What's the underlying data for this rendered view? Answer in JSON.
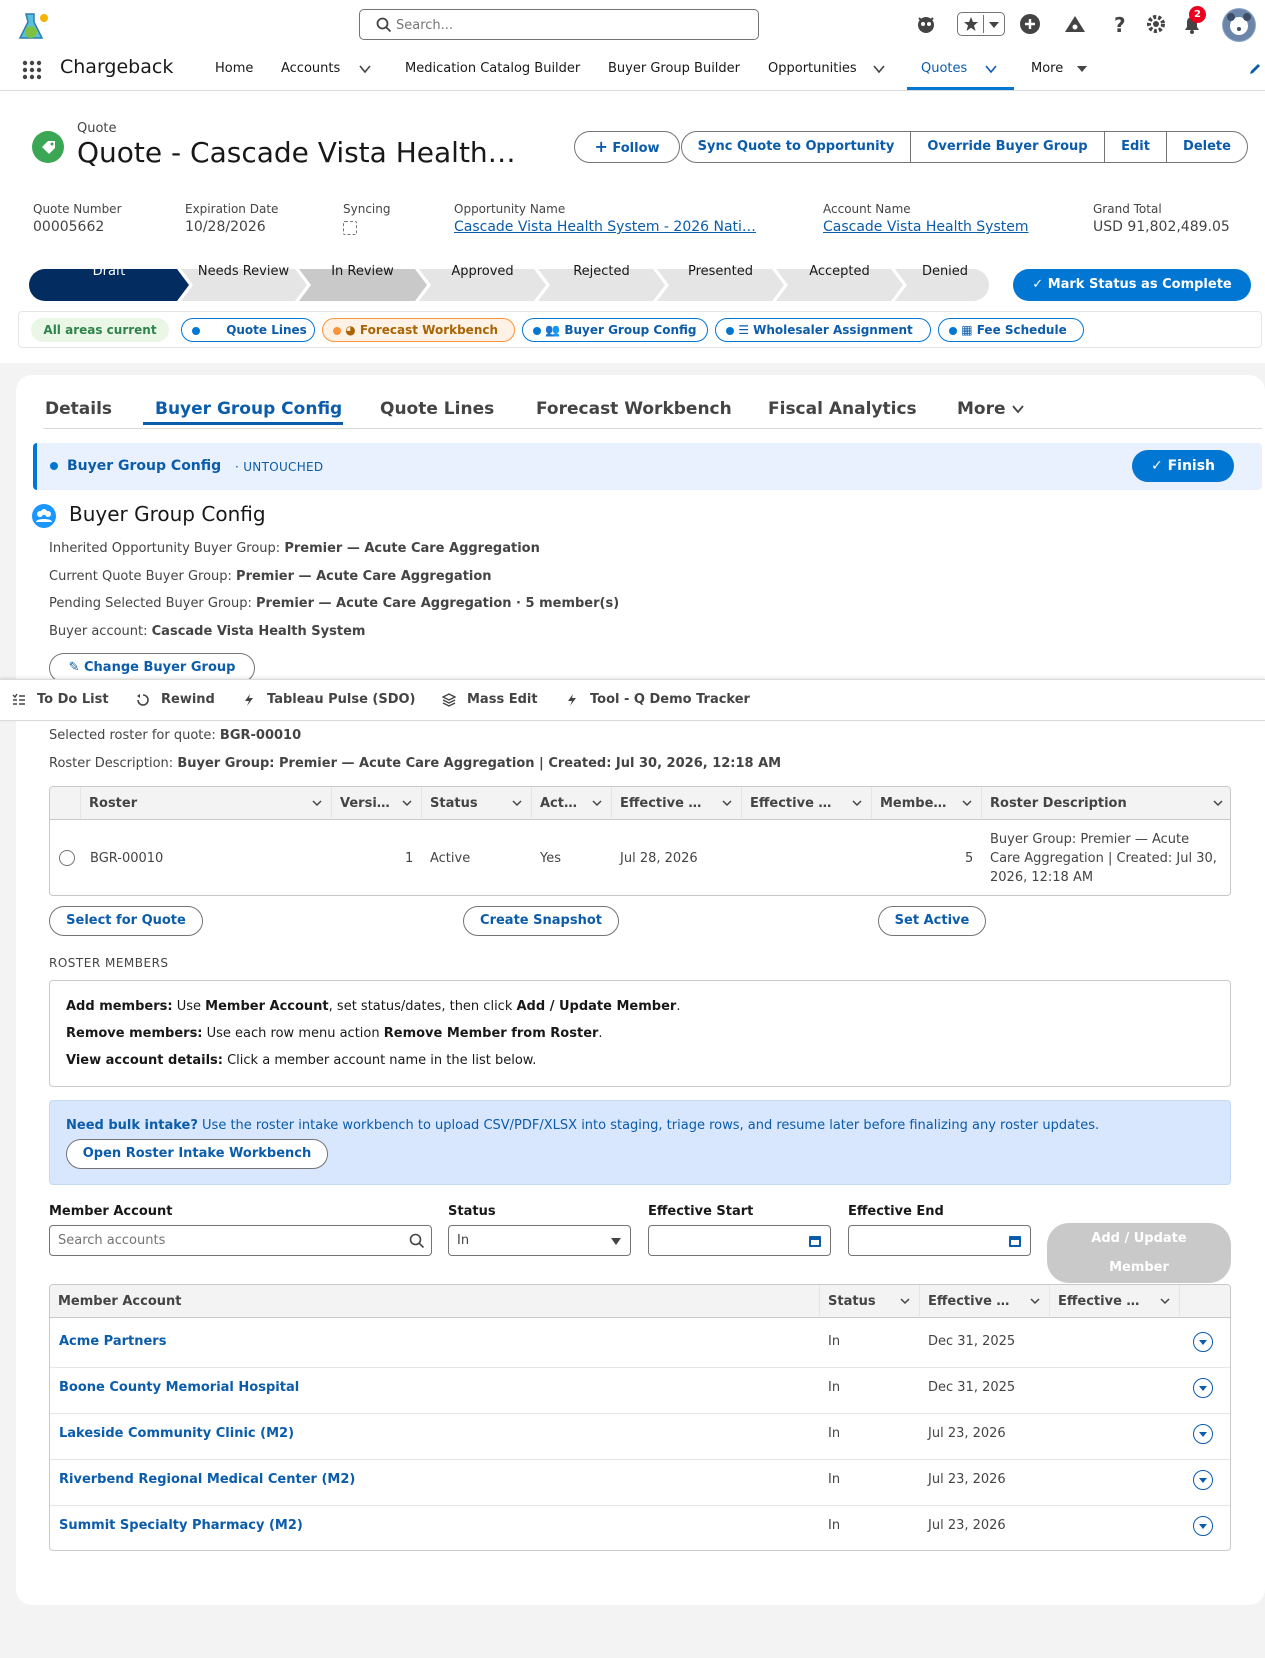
{
  "header": {
    "search_placeholder": "Search...",
    "notification_count": "2"
  },
  "nav": {
    "app_name": "Chargeback",
    "items": [
      "Home",
      "Accounts",
      "Medication Catalog Builder",
      "Buyer Group Builder",
      "Opportunities",
      "Quotes",
      "More"
    ],
    "active": "Quotes"
  },
  "record": {
    "type_label": "Quote",
    "title": "Quote - Cascade Vista Health…",
    "buttons": {
      "follow": "Follow",
      "sync": "Sync Quote to Opportunity",
      "override": "Override Buyer Group",
      "edit": "Edit",
      "delete": "Delete"
    },
    "fields": [
      {
        "label": "Quote Number",
        "value": "00005662"
      },
      {
        "label": "Expiration Date",
        "value": "10/28/2026"
      },
      {
        "label": "Syncing",
        "value": ""
      },
      {
        "label": "Opportunity Name",
        "value": "Cascade Vista Health System - 2026 Nati…"
      },
      {
        "label": "Account Name",
        "value": "Cascade Vista Health System"
      },
      {
        "label": "Grand Total",
        "value": "USD 91,802,489.05"
      }
    ]
  },
  "path": {
    "steps": [
      "Draft",
      "Needs Review",
      "In Review",
      "Approved",
      "Rejected",
      "Presented",
      "Accepted",
      "Denied"
    ],
    "current": "Draft",
    "mark_complete": "Mark Status as Complete"
  },
  "areas": {
    "status": "All areas current",
    "pills": [
      "Quote Lines",
      "Forecast Workbench",
      "Buyer Group Config",
      "Wholesaler Assignment",
      "Fee Schedule"
    ]
  },
  "tabs": {
    "items": [
      "Details",
      "Buyer Group Config",
      "Quote Lines",
      "Forecast Workbench",
      "Fiscal Analytics",
      "More"
    ],
    "active": "Buyer Group Config"
  },
  "step_banner": {
    "title": "Buyer Group Config",
    "state": "· UNTOUCHED",
    "finish": "Finish"
  },
  "buyer_group": {
    "section_title": "Buyer Group Config",
    "inherited_label": "Inherited Opportunity Buyer Group:",
    "inherited_value": "Premier — Acute Care Aggregation",
    "current_label": "Current Quote Buyer Group:",
    "current_value": "Premier — Acute Care Aggregation",
    "pending_label": "Pending Selected Buyer Group:",
    "pending_value": "Premier — Acute Care Aggregation · 5 member(s)",
    "buyer_label": "Buyer account:",
    "buyer_value": "Cascade Vista Health System",
    "change_button": "Change Buyer Group",
    "selected_roster_label": "Selected roster for quote:",
    "selected_roster_value": "BGR-00010",
    "roster_desc_label": "Roster Description:",
    "roster_desc_value": "Buyer Group: Premier — Acute Care Aggregation | Created: Jul 30, 2026, 12:18 AM"
  },
  "utility_bar": {
    "items": [
      "To Do List",
      "Rewind",
      "Tableau Pulse (SDO)",
      "Mass Edit",
      "Tool - Q Demo Tracker"
    ]
  },
  "roster_table": {
    "columns": [
      "Roster",
      "Versi…",
      "Status",
      "Act…",
      "Effective …",
      "Effective …",
      "Membe…",
      "Roster Description"
    ],
    "rows": [
      {
        "roster": "BGR-00010",
        "version": "1",
        "status": "Active",
        "active": "Yes",
        "effective_start": "Jul 28, 2026",
        "effective_end": "",
        "members": "5",
        "description_1": "Buyer Group: Premier — Acute",
        "description_2": "Care Aggregation | Created: Jul 30,",
        "description_3": "2026, 12:18 AM"
      }
    ],
    "actions": {
      "select": "Select for Quote",
      "snapshot": "Create Snapshot",
      "set_active": "Set Active"
    }
  },
  "roster_members": {
    "heading": "ROSTER MEMBERS",
    "help": {
      "add_label": "Add members:",
      "add_text_1": "Use",
      "add_bold_1": "Member Account",
      "add_text_2": ", set status/dates, then click",
      "add_bold_2": "Add / Update Member",
      "add_text_3": ".",
      "remove_label": "Remove members:",
      "remove_text_1": "Use each row menu action",
      "remove_bold": "Remove Member from Roster",
      "remove_text_2": ".",
      "view_label": "View account details:",
      "view_text": "Click a member account name in the list below."
    },
    "bulk": {
      "label": "Need bulk intake?",
      "text": "Use the roster intake workbench to upload CSV/PDF/XLSX into staging, triage rows, and resume later before finalizing any roster updates.",
      "button": "Open Roster Intake Workbench"
    },
    "form": {
      "member_label": "Member Account",
      "member_placeholder": "Search accounts",
      "status_label": "Status",
      "status_value": "In",
      "start_label": "Effective Start",
      "end_label": "Effective End",
      "add_update_1": "Add / Update",
      "add_update_2": "Member"
    },
    "table": {
      "columns": [
        "Member Account",
        "Status",
        "Effective …",
        "Effective …"
      ],
      "rows": [
        {
          "name": "Acme Partners",
          "status": "In",
          "start": "Dec 31, 2025",
          "end": ""
        },
        {
          "name": "Boone County Memorial Hospital",
          "status": "In",
          "start": "Dec 31, 2025",
          "end": ""
        },
        {
          "name": "Lakeside Community Clinic (M2)",
          "status": "In",
          "start": "Jul 23, 2026",
          "end": ""
        },
        {
          "name": "Riverbend Regional Medical Center (M2)",
          "status": "In",
          "start": "Jul 23, 2026",
          "end": ""
        },
        {
          "name": "Summit Specialty Pharmacy (M2)",
          "status": "In",
          "start": "Jul 23, 2026",
          "end": ""
        }
      ]
    }
  },
  "colors": {
    "brand": "#0176d3",
    "link": "#0b5cab",
    "success": "#3ba755",
    "warning": "#fe9339",
    "path_active": "#032d60"
  }
}
